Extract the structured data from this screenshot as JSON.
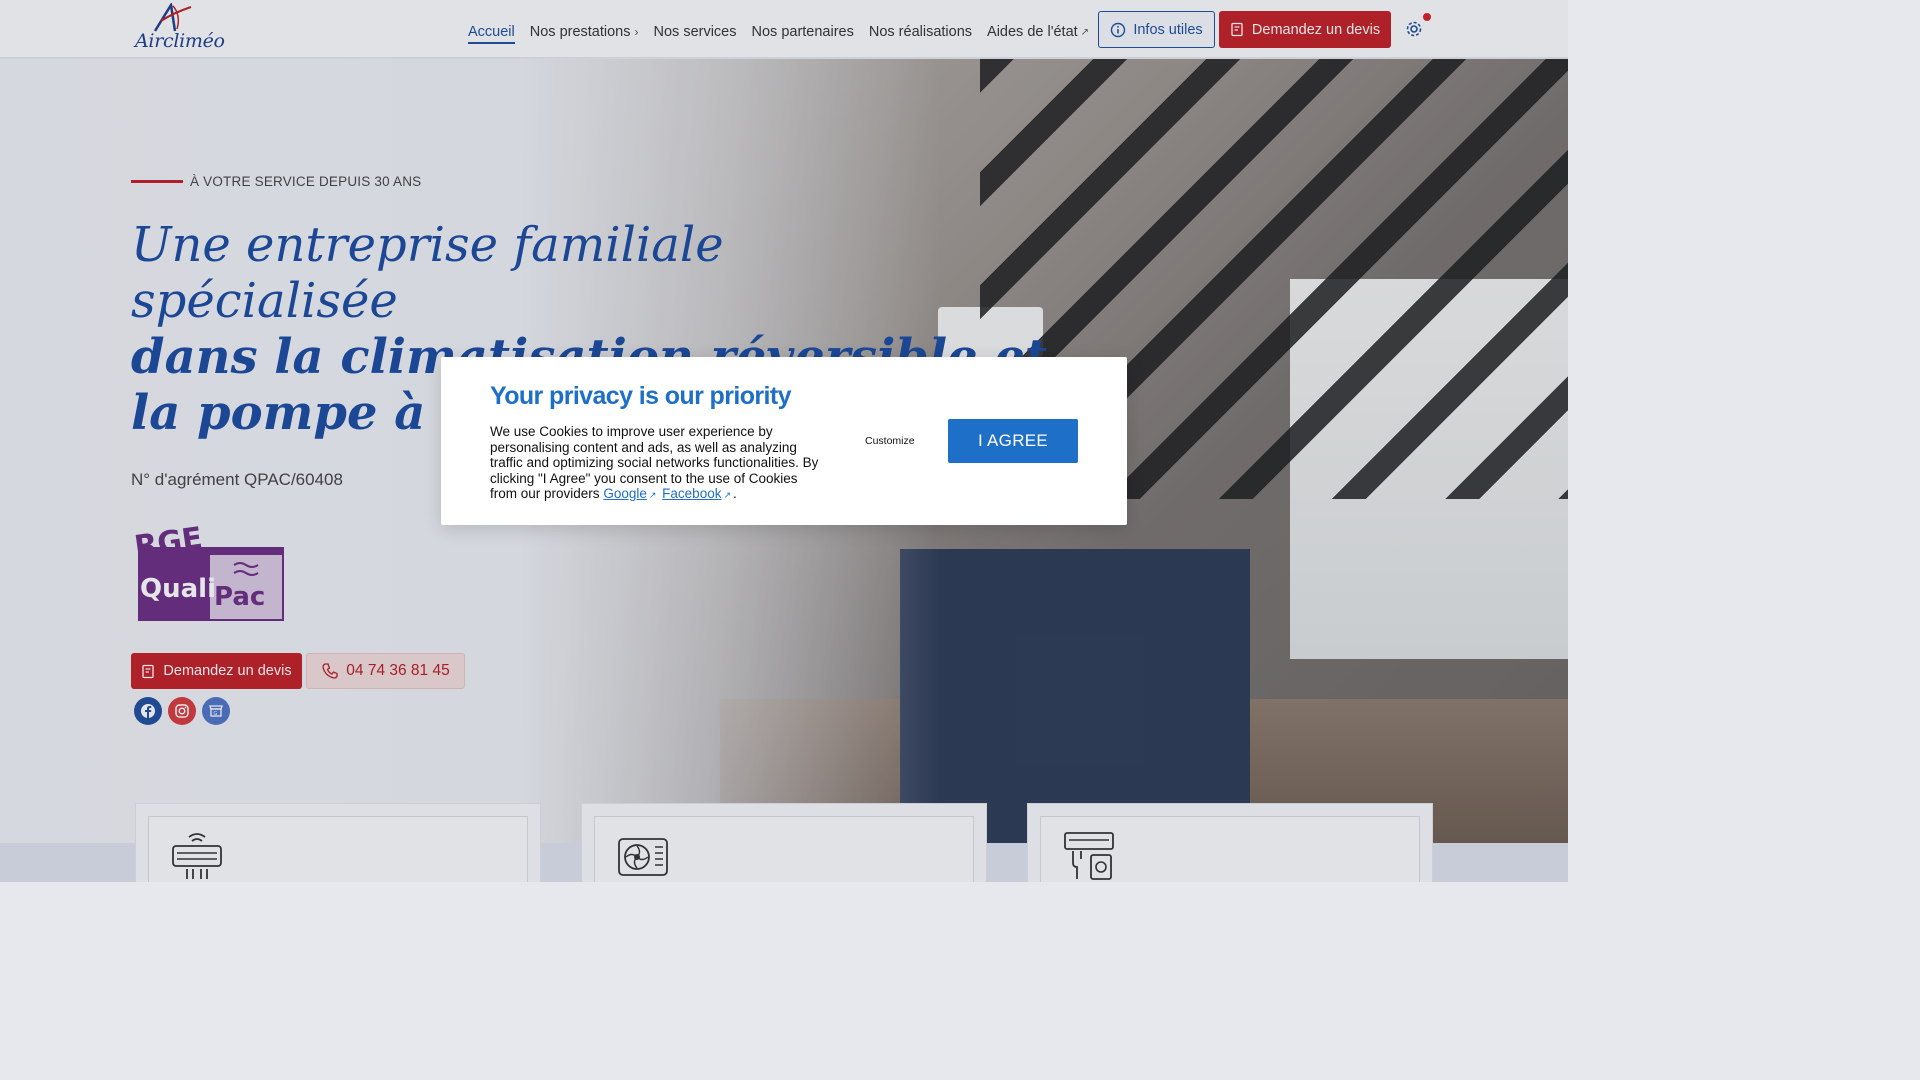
{
  "header": {
    "logo_text": "Aircliméo",
    "nav": [
      {
        "label": "Accueil"
      },
      {
        "label": "Nos prestations"
      },
      {
        "label": "Nos services"
      },
      {
        "label": "Nos partenaires"
      },
      {
        "label": "Nos réalisations"
      },
      {
        "label": "Aides de l'état"
      }
    ],
    "infos_label": "Infos utiles",
    "devis_label": "Demandez un devis",
    "icons": [
      "info-circle-icon",
      "quote-icon",
      "gear-icon"
    ]
  },
  "hero": {
    "tagline": "À VOTRE SERVICE DEPUIS 30 ANS",
    "title_line1": "Une entreprise familiale",
    "title_line2": "spécialisée",
    "title_line3": "dans la climatisation réversible et",
    "title_line4": "la pompe à chaleur",
    "agrement": "N° d'agrément QPAC/60408",
    "rge_badge": {
      "line1": "RGE",
      "line2": "Quali",
      "line3": "Pac"
    },
    "cta_devis": "Demandez un devis",
    "cta_phone": "04 74 36 81 45",
    "socials": [
      "facebook-icon",
      "instagram-icon",
      "google-business-icon"
    ]
  },
  "cards": [
    "air-conditioner-icon",
    "outdoor-unit-icon",
    "heat-pump-icon"
  ],
  "cookie_modal": {
    "title": "Your privacy is our priority",
    "text": "We use Cookies to improve user experience by personalising content and ads, as well as analyzing traffic and optimizing social networks functionalities. By clicking \"I Agree\" you consent to the use of Cookies from our providers",
    "link_google": "Google",
    "link_facebook": "Facebook",
    "period": ".",
    "customize_label": "Customize",
    "agree_label": "I AGREE"
  },
  "colors": {
    "brand_blue": "#1a4aa0",
    "brand_red": "#c21f24",
    "modal_blue": "#1e6fc7"
  }
}
